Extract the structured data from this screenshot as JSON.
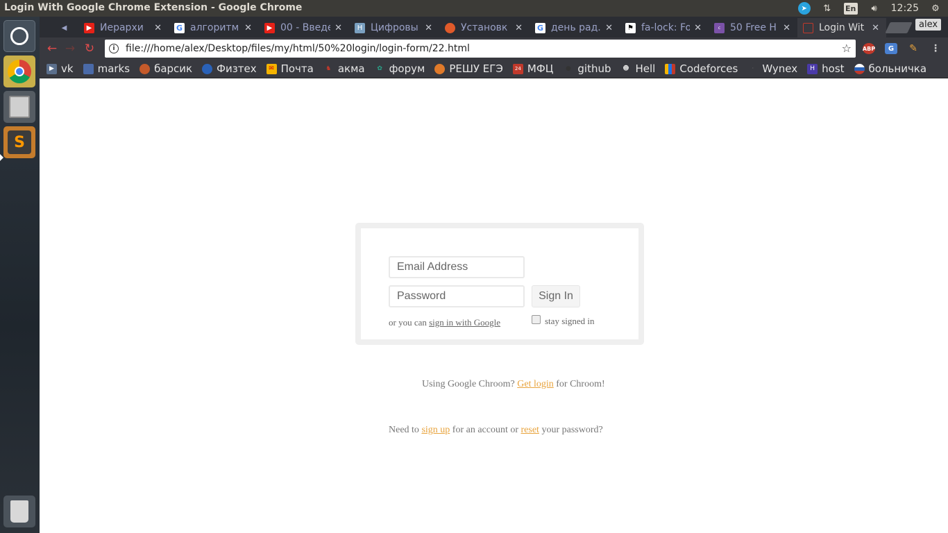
{
  "window": {
    "title": "Login With Google Chrome Extension - Google Chrome"
  },
  "tray": {
    "lang": "En",
    "time": "12:25"
  },
  "tabs": [
    {
      "title": "Иерархи",
      "favicon": "youtube-icon"
    },
    {
      "title": "алгоритм",
      "favicon": "google-icon"
    },
    {
      "title": "00 - Введе",
      "favicon": "youtube-icon"
    },
    {
      "title": "Цифровы",
      "favicon": "h-icon"
    },
    {
      "title": "Установк",
      "favicon": "ubuntu-icon"
    },
    {
      "title": "день рад...",
      "favicon": "google-icon"
    },
    {
      "title": "fa-lock: Fo",
      "favicon": "flag-icon"
    },
    {
      "title": "50 Free H",
      "favicon": "colorlib-icon"
    },
    {
      "title": "Login Wit",
      "favicon": "page-icon"
    }
  ],
  "profile": "alex",
  "address_bar": {
    "url": "file:///home/alex/Desktop/files/my/html/50%20login/login-form/22.html"
  },
  "extensions": [
    {
      "label": "ABP"
    },
    {
      "label": "G"
    }
  ],
  "bookmarks": [
    {
      "label": "vk"
    },
    {
      "label": "marks"
    },
    {
      "label": "барсик"
    },
    {
      "label": "Физтех"
    },
    {
      "label": "Почта"
    },
    {
      "label": "акма"
    },
    {
      "label": "форум"
    },
    {
      "label": "РЕШУ ЕГЭ"
    },
    {
      "label": "МФЦ"
    },
    {
      "label": "github"
    },
    {
      "label": "Hell"
    },
    {
      "label": "Codeforces"
    },
    {
      "label": "Wynex"
    },
    {
      "label": "host"
    },
    {
      "label": "больничка"
    }
  ],
  "login": {
    "email_placeholder": "Email Address",
    "password_placeholder": "Password",
    "signin_label": "Sign In",
    "alt_prefix": "or you can ",
    "alt_link": "sign in with Google",
    "stay_label": "stay signed in"
  },
  "footer": {
    "line1_prefix": "Using Google Chroom? ",
    "line1_link": "Get login",
    "line1_suffix": " for Chroom!",
    "line2_prefix": "Need to ",
    "line2_link1": "sign up",
    "line2_middle": " for an account or ",
    "line2_link2": "reset",
    "line2_suffix": " your password?"
  }
}
